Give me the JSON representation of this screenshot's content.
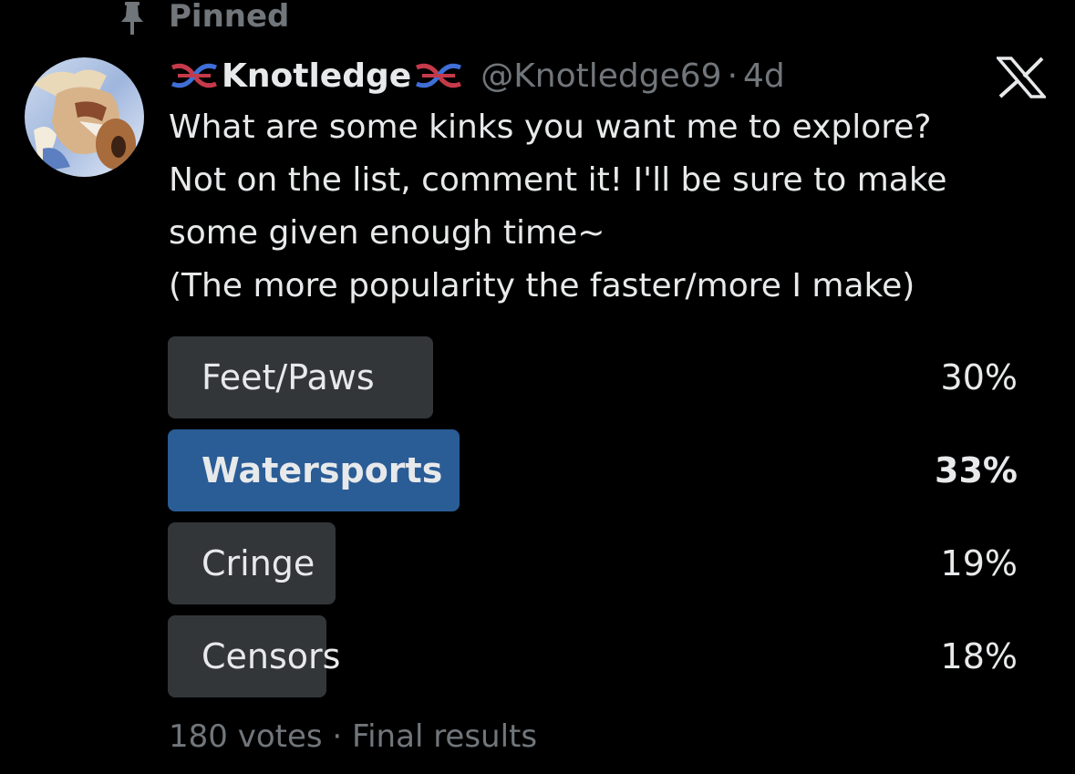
{
  "pinned": {
    "label": "Pinned",
    "icon": "pin-icon"
  },
  "author": {
    "avatar_icon": "avatar",
    "display_name": "Knotledge",
    "name_decoration_icon": "knot-icon",
    "handle": "@Knotledge69",
    "separator": "·",
    "time": "4d"
  },
  "app_logo_icon": "x-logo-icon",
  "tweet": {
    "lines": [
      "What are some kinks you want me to explore?",
      "Not on the list, comment it! I'll be sure to make",
      "some given enough time~",
      "(The more popularity the faster/more I make)"
    ]
  },
  "poll": {
    "options": [
      {
        "label": "Feet/Paws",
        "percent_text": "30%",
        "percent": 30,
        "winner": false
      },
      {
        "label": "Watersports",
        "percent_text": "33%",
        "percent": 33,
        "winner": true
      },
      {
        "label": "Cringe",
        "percent_text": "19%",
        "percent": 19,
        "winner": false
      },
      {
        "label": "Censors",
        "percent_text": "18%",
        "percent": 18,
        "winner": false
      }
    ],
    "votes": "180 votes",
    "separator": "·",
    "status": "Final results"
  },
  "colors": {
    "background": "#000000",
    "text": "#e7e9ea",
    "muted": "#71767b",
    "bar": "#333639",
    "winner_bar": "#2a5c96"
  }
}
